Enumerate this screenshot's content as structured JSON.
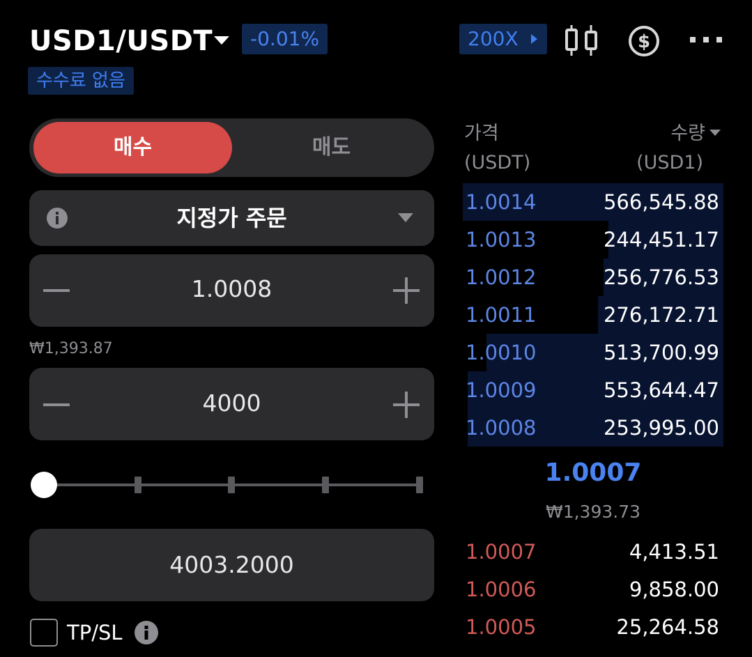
{
  "header": {
    "pair": "USD1/USDT",
    "change": "-0.01%",
    "no_fee_badge": "수수료 없음",
    "leverage": "200X"
  },
  "order_form": {
    "buy_label": "매수",
    "sell_label": "매도",
    "order_type": "지정가 주문",
    "price_value": "1.0008",
    "price_krw": "₩1,393.87",
    "quantity_value": "4000",
    "slider_percent": 0,
    "total_value": "4003.2000",
    "tpsl_label": "TP/SL",
    "tpsl_checked": false
  },
  "order_book": {
    "price_header": "가격",
    "price_unit": "(USDT)",
    "qty_header": "수량",
    "qty_unit": "(USD1)",
    "asks": [
      {
        "price": "1.0014",
        "qty": "566,545.88",
        "depth": 1.0
      },
      {
        "price": "1.0013",
        "qty": "244,451.17",
        "depth": 0.44
      },
      {
        "price": "1.0012",
        "qty": "256,776.53",
        "depth": 0.46
      },
      {
        "price": "1.0011",
        "qty": "276,172.71",
        "depth": 0.48
      },
      {
        "price": "1.0010",
        "qty": "513,700.99",
        "depth": 0.91
      },
      {
        "price": "1.0009",
        "qty": "553,644.47",
        "depth": 0.98
      },
      {
        "price": "1.0008",
        "qty": "253,995.00",
        "depth": 0.98
      }
    ],
    "mid_price": "1.0007",
    "mid_price_krw": "₩1,393.73",
    "bids": [
      {
        "price": "1.0007",
        "qty": "4,413.51"
      },
      {
        "price": "1.0006",
        "qty": "9,858.00"
      },
      {
        "price": "1.0005",
        "qty": "25,264.58"
      }
    ],
    "colors": {
      "ask": "#5d86e6",
      "bid": "#d15a58",
      "accent": "#4a82f0",
      "buy": "#d64a47"
    }
  }
}
